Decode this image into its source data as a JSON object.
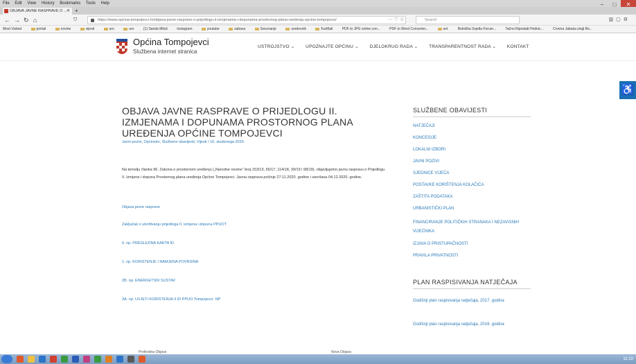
{
  "browser": {
    "menu": [
      "File",
      "Edit",
      "View",
      "History",
      "Bookmarks",
      "Tools",
      "Help"
    ],
    "tab_title": "OBJAVA JAVNE RASPRAVE O ...",
    "url": "https://www.opcina-tompojevci.hr/objava-javne-rasprave-o-prijedlogu-ii-izmjenama-i-dopunama-prostornog-plana-uredenja-opcine-tompojevci/",
    "search_placeholder": "Search",
    "bookmarks": [
      "Most Visited",
      "portali",
      "novine",
      "vijesti",
      "uro",
      "uro",
      "(1) Sanda Miloš",
      "Instagram",
      "youtube",
      "zabava",
      "Sveznanje",
      "uredovnik",
      "KurMail",
      "PDF to JPG online con...",
      "PDF to Word Converter...",
      "sel.",
      "Bolnička Svjetla Forum...",
      "Tačno Ripostalt Hodnic...",
      "Crvena Jabuka singl Bo..."
    ]
  },
  "site": {
    "title": "Općina Tompojevci",
    "subtitle": "Službena internet stranica",
    "nav": [
      "USTROJSTVO ⌄",
      "UPOZNAJTE OPĆINU ⌄",
      "DJELOKRUG RADA ⌄",
      "TRANSPARENTNOST RADA ⌄",
      "KONTAKT"
    ]
  },
  "article": {
    "title": "OBJAVA JAVNE RASPRAVE O PRIJEDLOGU II. IZMJENAMA I DOPUNAMA PROSTORNOG PLANA UREĐENJA OPĆINE TOMPOJEVCI",
    "meta": "Javni pozivi, Općinsko, Službene obavijesti, Vijesti / 16. studenoga 2020.",
    "body": "Na temelju članka 96. Zakona o prostornom uređenju („Narodne novine“ broj 153/13, 65/17, 114/18, 39/19 i 98/19), objavljujemo javnu raspravu o Prijedlogu II. Izmjena i dopuna Prostornog plana uređenja Općine Tompojevci. Javna rasprava počinje 27.11.2020. godine i završava 04.12.2020. godine.",
    "links": [
      "Objava javne rasprave",
      "Zaključak o utvrđivanju prijedloga II. izmjena i dopuna PPUOT",
      "0. np. PREGLEDNA KARTA ID",
      "1. np. KORISTENJE I NAMJENA POVRSINA",
      "2B. np. ENERGETSKI SUSTAV",
      "3A. np. UVJETI KORISTENJA II ID PPUO Tompojevci- NP"
    ]
  },
  "sidebar": {
    "heading1": "SLUŽBENE OBAVIJESTI",
    "links1": [
      "NATJEČAJI",
      "KONCESIJE",
      "LOKALNI IZBORI",
      "JAVNI POZIVI",
      "SJEDNICE VIJEĆA",
      "POSTAVKE KORIŠTENJA KOLAČIĆA",
      "ZAŠTITA PODATAKA",
      "URBANISTIČKI PLAN",
      "FINANCIRANJE POLITIČKIH STRANAKA I NEZAVISNIH VIJEĆNIKA",
      "IZJAVA O PRISTUPAČNOSTI",
      "PRAVILA PRIVATNOSTI"
    ],
    "heading2": "PLAN RASPISIVANJA NATJEČAJA",
    "links2": [
      "Godišnji plan raspisivanja natječaja, 2017. godina",
      "Godišnji plan raspisivanja natječaja, 2016. godina"
    ]
  },
  "footer": {
    "prev": "Prethodna Objava",
    "next": "Nova Objava",
    "clock": "11:10"
  },
  "colors": {
    "link": "#2a7ab8",
    "accessibility": "#1a6fb5",
    "crest_red": "#c0392b",
    "crest_blue": "#1f4f9c"
  }
}
